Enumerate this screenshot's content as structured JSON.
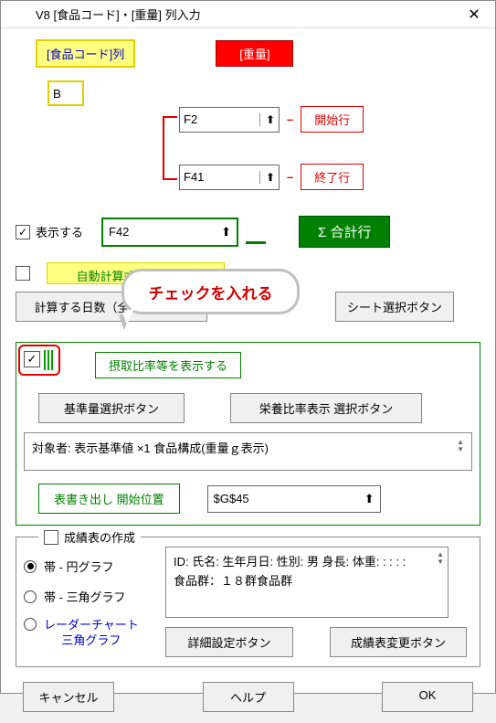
{
  "window": {
    "title": "V8 [食品コード]・[重量] 列入力"
  },
  "headers": {
    "food_code_col": "[食品コード]列",
    "weight": "[重量]"
  },
  "fields": {
    "col_letter": "B",
    "start_cell": "F2",
    "end_cell": "F41",
    "sum_cell": "F42",
    "export_cell": "$G$45"
  },
  "labels": {
    "start_row": "開始行",
    "end_row": "終了行",
    "show": "表示する",
    "sum_row": "Σ 合計行",
    "auto_calc": "自動計算式を埋め込む",
    "calc_days_btn": "計算する日数（全シート数）",
    "sheet_select_btn": "シート選択ボタン",
    "ratio_display": "摂取比率等を表示する",
    "std_select_btn": "基準量選択ボタン",
    "nut_ratio_btn": "栄養比率表示 選択ボタン",
    "target_text": "対象者: 表示基準値 ×1  食品構成(重量ｇ表示)",
    "export_label": "表書き出し 開始位置",
    "result_create": "成績表の作成",
    "radio_pie": "帯 - 円グラフ",
    "radio_tri": "帯 - 三角グラフ",
    "radio_radar": "レーダーチャート\n三角グラフ",
    "info_line1": "ID:  氏名:  生年月日:  性別: 男 身長:  体重:  :  :  :  :",
    "info_line2": "食品群：１８群食品群",
    "detail_btn": "詳細設定ボタン",
    "change_btn": "成績表変更ボタン",
    "cancel": "キャンセル",
    "help": "ヘルプ",
    "ok": "OK"
  },
  "callout": {
    "text": "チェックを入れる"
  },
  "state": {
    "show_checked": true,
    "auto_checked": false,
    "ratio_checked": true,
    "result_checked": false,
    "radio_selected": 0
  }
}
